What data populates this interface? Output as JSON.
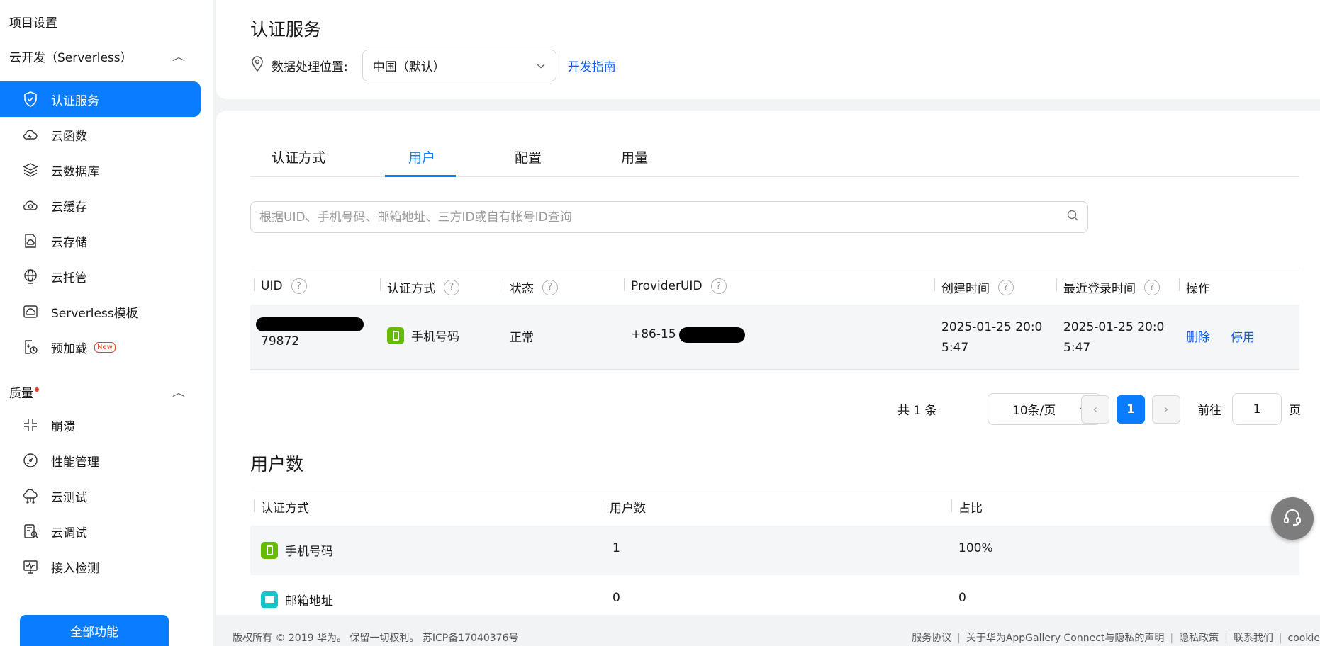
{
  "sidebar": {
    "project_settings": "项目设置",
    "group_serverless": "云开发（Serverless）",
    "items": [
      {
        "label": "认证服务",
        "icon": "shield-check-icon",
        "active": true
      },
      {
        "label": "云函数",
        "icon": "cloud-function-icon"
      },
      {
        "label": "云数据库",
        "icon": "database-layers-icon"
      },
      {
        "label": "云缓存",
        "icon": "cloud-cache-icon"
      },
      {
        "label": "云存储",
        "icon": "cloud-storage-icon"
      },
      {
        "label": "云托管",
        "icon": "globe-icon"
      },
      {
        "label": "Serverless模板",
        "icon": "cloud-template-icon"
      },
      {
        "label": "预加载",
        "icon": "preload-clock-icon",
        "badge": "New"
      }
    ],
    "group_quality": "质量",
    "quality_items": [
      {
        "label": "崩溃",
        "icon": "crash-icon"
      },
      {
        "label": "性能管理",
        "icon": "gauge-icon"
      },
      {
        "label": "云测试",
        "icon": "cloud-test-icon"
      },
      {
        "label": "云调试",
        "icon": "cloud-debug-icon"
      },
      {
        "label": "接入检测",
        "icon": "monitor-pulse-icon"
      }
    ],
    "all_features": "全部功能"
  },
  "header": {
    "title": "认证服务",
    "location_label": "数据处理位置:",
    "region_value": "中国（默认）",
    "guide_link": "开发指南"
  },
  "tabs": [
    "认证方式",
    "用户",
    "配置",
    "用量"
  ],
  "active_tab": "用户",
  "search": {
    "placeholder": "根据UID、手机号码、邮箱地址、三方ID或自有帐号ID查询"
  },
  "users_table": {
    "columns": [
      "UID",
      "认证方式",
      "状态",
      "ProviderUID",
      "创建时间",
      "最近登录时间",
      "操作"
    ],
    "rows": [
      {
        "uid_suffix": "79872",
        "auth_method": "手机号码",
        "status": "正常",
        "provider_uid_prefix": "+86-15",
        "created_line1": "2025-01-25 20:0",
        "created_line2": "5:47",
        "last_login_line1": "2025-01-25 20:0",
        "last_login_line2": "5:47",
        "action_delete": "删除",
        "action_disable": "停用"
      }
    ]
  },
  "pagination": {
    "total": "共 1 条",
    "page_size": "10条/页",
    "current_page": "1",
    "goto_label": "前往",
    "goto_value": "1",
    "page_unit": "页",
    "prev": "‹",
    "next": "›"
  },
  "user_count": {
    "title": "用户数",
    "columns": [
      "认证方式",
      "用户数",
      "占比"
    ],
    "rows": [
      {
        "method": "手机号码",
        "icon": "phone-icon",
        "count": "1",
        "ratio": "100%"
      },
      {
        "method": "邮箱地址",
        "icon": "mail-icon",
        "count": "0",
        "ratio": "0"
      }
    ]
  },
  "footer": {
    "copyright": "版权所有 © 2019 华为。 保留一切权利。 苏ICP备17040376号",
    "links": [
      "服务协议",
      "关于华为AppGallery Connect与隐私的声明",
      "隐私政策",
      "联系我们",
      "cookie"
    ]
  },
  "colors": {
    "accent": "#0a7cff",
    "link": "#0a59f7",
    "phone_badge": "#64bb00",
    "mail_badge": "#17c4c9",
    "new_badge": "#e84026"
  }
}
